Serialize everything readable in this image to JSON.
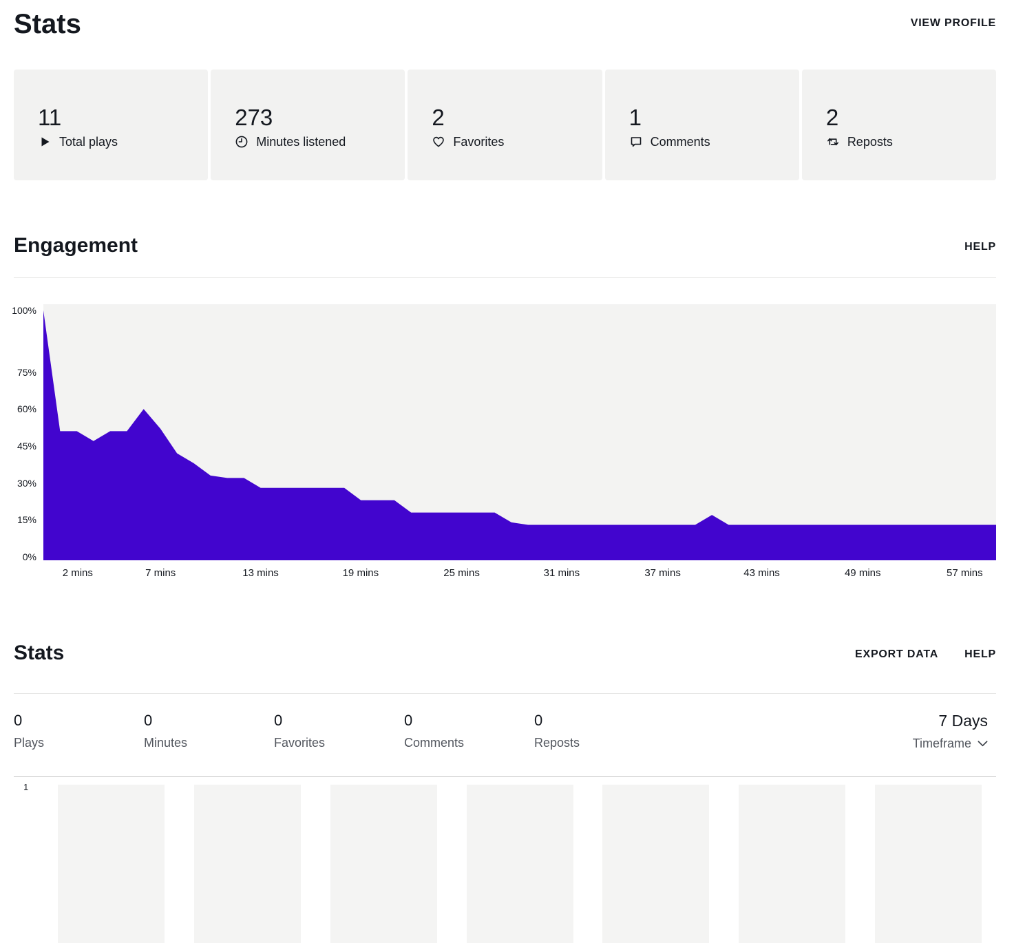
{
  "header": {
    "title": "Stats",
    "view_profile_label": "VIEW PROFILE"
  },
  "summary_cards": [
    {
      "value": "11",
      "label": "Total plays",
      "icon": "play-icon"
    },
    {
      "value": "273",
      "label": "Minutes listened",
      "icon": "clock-icon"
    },
    {
      "value": "2",
      "label": "Favorites",
      "icon": "heart-icon"
    },
    {
      "value": "1",
      "label": "Comments",
      "icon": "comment-icon"
    },
    {
      "value": "2",
      "label": "Reposts",
      "icon": "repost-icon"
    }
  ],
  "engagement": {
    "title": "Engagement",
    "help_label": "HELP"
  },
  "stats_section": {
    "title": "Stats",
    "export_label": "EXPORT DATA",
    "help_label": "HELP",
    "metrics": [
      {
        "value": "0",
        "label": "Plays"
      },
      {
        "value": "0",
        "label": "Minutes"
      },
      {
        "value": "0",
        "label": "Favorites"
      },
      {
        "value": "0",
        "label": "Comments"
      },
      {
        "value": "0",
        "label": "Reposts"
      }
    ],
    "timeframe": {
      "value": "7 Days",
      "label": "Timeframe",
      "chevron_icon": "chevron-down-icon"
    }
  },
  "chart_data": [
    {
      "type": "area",
      "title": "Engagement",
      "x_unit": "minutes",
      "x_start": 0,
      "x_step": 1,
      "values": [
        100,
        51,
        51,
        47,
        51,
        51,
        60,
        52,
        42,
        38,
        33,
        32,
        32,
        28,
        28,
        28,
        28,
        28,
        28,
        23,
        23,
        23,
        18,
        18,
        18,
        18,
        18,
        18,
        14,
        13,
        13,
        13,
        13,
        13,
        13,
        13,
        13,
        13,
        13,
        13,
        17,
        13,
        13,
        13,
        13,
        13,
        13,
        13,
        13,
        13,
        13,
        13,
        13,
        13,
        13,
        13,
        13,
        13
      ],
      "ylim": [
        0,
        100
      ],
      "y_ticks": [
        {
          "label": "100%",
          "value": 100
        },
        {
          "label": "75%",
          "value": 75
        },
        {
          "label": "60%",
          "value": 60
        },
        {
          "label": "45%",
          "value": 45
        },
        {
          "label": "30%",
          "value": 30
        },
        {
          "label": "15%",
          "value": 15
        },
        {
          "label": "0%",
          "value": 0
        }
      ],
      "x_ticks": [
        {
          "label": "2 mins",
          "frac": 0.036
        },
        {
          "label": "7 mins",
          "frac": 0.123
        },
        {
          "label": "13 mins",
          "frac": 0.228
        },
        {
          "label": "19 mins",
          "frac": 0.333
        },
        {
          "label": "25 mins",
          "frac": 0.439
        },
        {
          "label": "31 mins",
          "frac": 0.544
        },
        {
          "label": "37 mins",
          "frac": 0.65
        },
        {
          "label": "43 mins",
          "frac": 0.754
        },
        {
          "label": "49 mins",
          "frac": 0.86
        },
        {
          "label": "57 mins",
          "frac": 0.967
        }
      ],
      "grid": false,
      "legend": "none",
      "fill_color": "#4205CE",
      "plot_bg": "#F3F3F2"
    },
    {
      "type": "bar",
      "title": "Stats",
      "categories": [
        "",
        "",
        "",
        "",
        "",
        "",
        ""
      ],
      "values": [
        0,
        0,
        0,
        0,
        0,
        0,
        0
      ],
      "y_axis_top_label": "1",
      "bar_color": "#F4F4F3"
    }
  ],
  "colors": {
    "accent": "#4205CE",
    "chart_bg": "#F3F3F2",
    "card_bg": "#F2F2F1",
    "placeholder_bg": "#F4F4F3",
    "text_dark": "#14181F",
    "text_gray": "#52565E",
    "divider": "#E6E6E5",
    "gridline": "#C9C9C9"
  }
}
